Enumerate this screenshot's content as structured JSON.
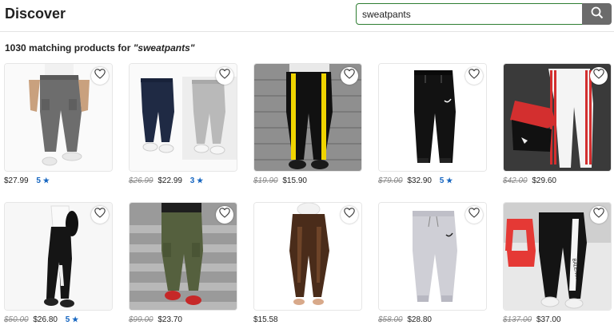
{
  "header": {
    "title": "Discover"
  },
  "search": {
    "value": "sweatpants",
    "button_icon": "search-icon"
  },
  "results": {
    "count_text": "1030 matching products for",
    "query_text": "\"sweatpants\""
  },
  "products": [
    {
      "name": "grey-cargo-joggers",
      "old_price": "",
      "price": "$27.99",
      "rating": "5"
    },
    {
      "name": "navy-and-grey-joggers",
      "old_price": "$26.99",
      "price": "$22.99",
      "rating": "3"
    },
    {
      "name": "black-yellow-stripe-pants",
      "old_price": "$19.90",
      "price": "$15.90",
      "rating": ""
    },
    {
      "name": "black-nike-joggers",
      "old_price": "$79.00",
      "price": "$32.90",
      "rating": "5"
    },
    {
      "name": "adidas-track-pants-set",
      "old_price": "$42.00",
      "price": "$29.60",
      "rating": ""
    },
    {
      "name": "black-side-print-leggings",
      "old_price": "$50.00",
      "price": "$26.80",
      "rating": "5"
    },
    {
      "name": "olive-cargo-pants",
      "old_price": "$99.00",
      "price": "$23.70",
      "rating": ""
    },
    {
      "name": "brown-shiny-leggings",
      "old_price": "",
      "price": "$15.58",
      "rating": ""
    },
    {
      "name": "grey-nike-joggers",
      "old_price": "$58.00",
      "price": "$28.80",
      "rating": ""
    },
    {
      "name": "balenciaga-track-pants",
      "old_price": "$137.00",
      "price": "$37.00",
      "rating": ""
    }
  ],
  "colors": {
    "accent": "#2e7d32",
    "rating": "#1565c0",
    "search_button": "#6b6b6b"
  }
}
